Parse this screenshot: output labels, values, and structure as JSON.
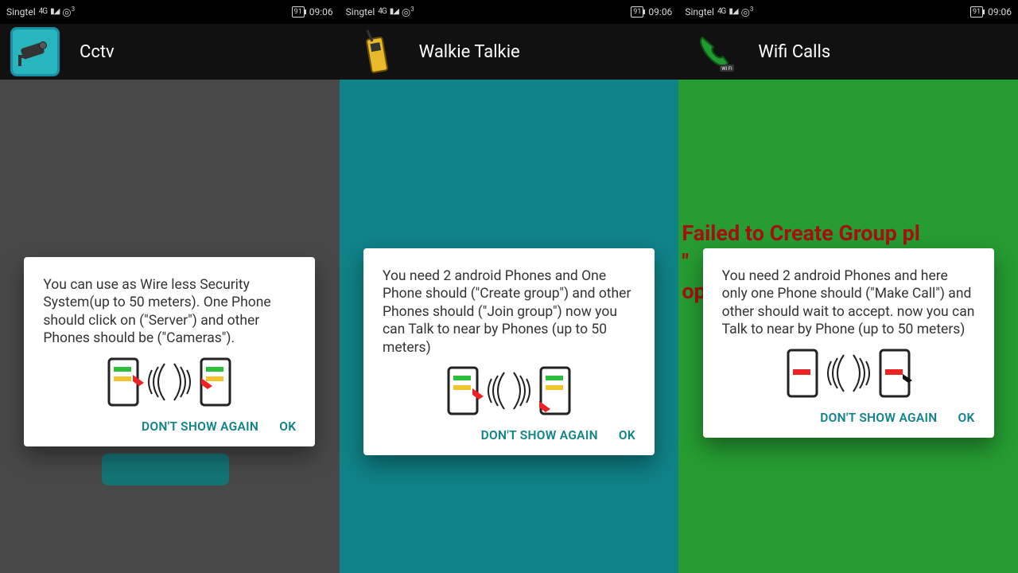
{
  "status": {
    "carrier": "Singtel",
    "net_badge": "4G",
    "hotspot_sup": "3",
    "battery": "91",
    "time": "09:06"
  },
  "panels": [
    {
      "title": "Cctv",
      "dialog": {
        "message": "You can use as Wire less Security System(up to 50 meters). One Phone should click on (\"Server\") and other Phones should be (\"Cameras\").",
        "dont_show": "DON'T SHOW AGAIN",
        "ok": "OK"
      }
    },
    {
      "title": "Walkie Talkie",
      "dialog": {
        "message": "You need 2 android Phones and One Phone should (\"Create group\") and other Phones should (\"Join group\") now you can Talk to near by Phones (up to 50 meters)",
        "dont_show": "DON'T SHOW AGAIN",
        "ok": "OK"
      }
    },
    {
      "title": "Wifi Calls",
      "error": "Failed to Create Group pl                                  \" \nop",
      "dialog": {
        "message": "You need 2 android Phones and here only one Phone should (\"Make Call\") and other should wait to accept. now you can Talk to near by Phone (up to 50 meters)",
        "dont_show": "DON'T SHOW AGAIN",
        "ok": "OK"
      }
    }
  ]
}
